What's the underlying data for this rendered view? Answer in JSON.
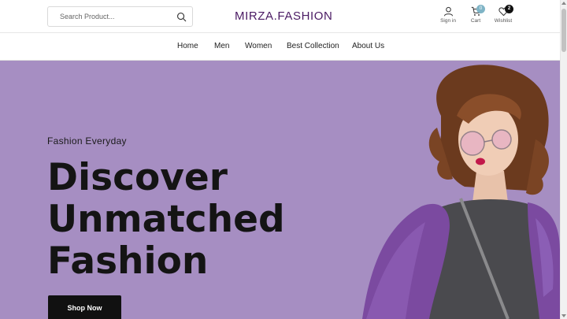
{
  "header": {
    "search_placeholder": "Search Product...",
    "logo": "MIRZA.FASHION",
    "sign_in_label": "Sign in",
    "cart_label": "Cart",
    "cart_count": "0",
    "wishlist_label": "Wishlist",
    "wishlist_count": "2"
  },
  "nav": {
    "items": [
      {
        "label": "Home"
      },
      {
        "label": "Men"
      },
      {
        "label": "Women"
      },
      {
        "label": "Best Collection"
      },
      {
        "label": "About Us"
      }
    ]
  },
  "hero": {
    "eyebrow": "Fashion Everyday",
    "headline_lines": [
      "Discover",
      "Unmatched",
      "Fashion"
    ],
    "cta_label": "Shop Now",
    "background_color": "#a68ec2"
  },
  "colors": {
    "logo": "#4a1a63",
    "cart_badge": "#7fb4c6",
    "wishlist_badge": "#111111",
    "cta": "#111111"
  }
}
